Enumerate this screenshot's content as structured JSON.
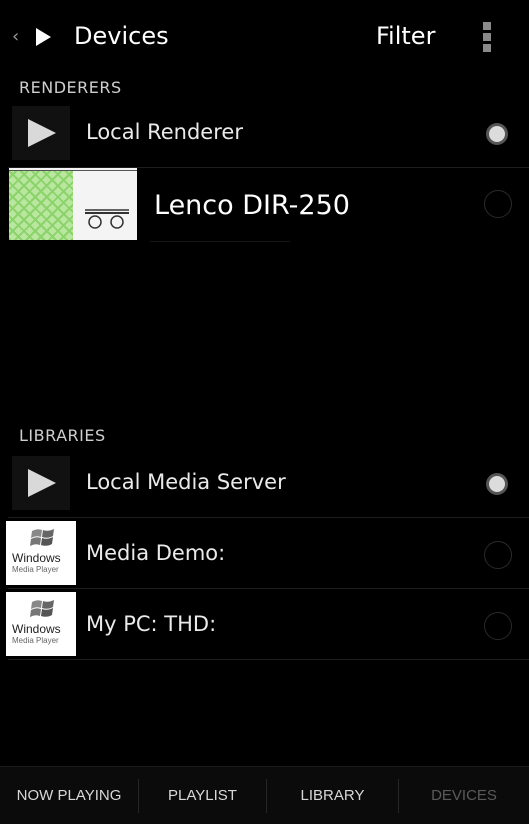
{
  "action_bar": {
    "back_glyph": "‹",
    "title": "Devices",
    "filter_label": "Filter",
    "overflow_icon": "overflow-menu-icon"
  },
  "renderers": {
    "header": "RENDERERS",
    "items": [
      {
        "label": "Local Renderer",
        "icon": "play-icon",
        "selected": true
      },
      {
        "label": "Lenco DIR-250",
        "icon": "lenco-device-thumbnail",
        "selected": false
      }
    ]
  },
  "libraries": {
    "header": "LIBRARIES",
    "items": [
      {
        "label": "Local Media Server",
        "icon": "play-icon",
        "selected": true
      },
      {
        "label": "Media Demo:",
        "icon": "windows-media-player-logo",
        "selected": false
      },
      {
        "label": "My PC:  THD:",
        "icon": "windows-media-player-logo",
        "selected": false
      }
    ]
  },
  "wmp_logo": {
    "word": "Windows",
    "sub": "Media Player"
  },
  "tabs": [
    {
      "label": "NOW PLAYING",
      "active": true
    },
    {
      "label": "PLAYLIST",
      "active": true
    },
    {
      "label": "LIBRARY",
      "active": true
    },
    {
      "label": "DEVICES",
      "active": false
    }
  ],
  "colors": {
    "background": "#000000",
    "text": "#e6e6e6",
    "dim_tab": "#5a5a5a"
  }
}
